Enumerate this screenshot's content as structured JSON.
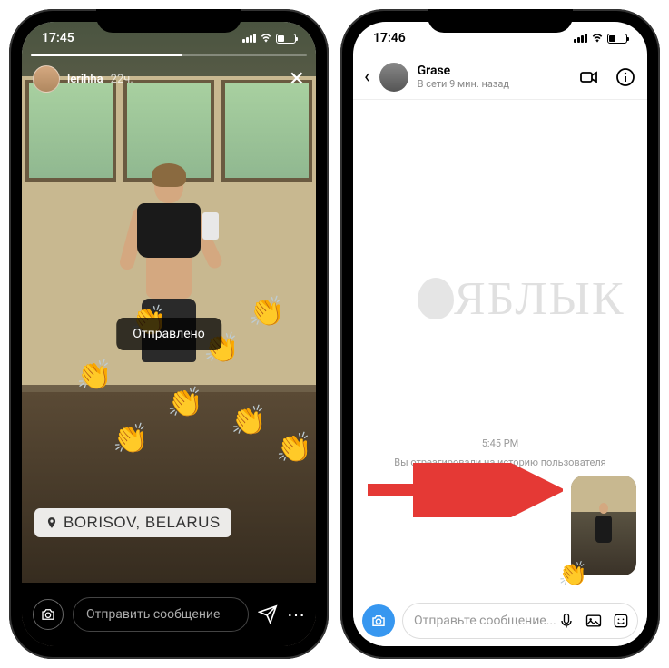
{
  "phone1": {
    "status_time": "17:45",
    "story": {
      "username": "lerihha",
      "time": "22ч.",
      "toast": "Отправлено",
      "location": "BORISOV, BELARUS",
      "reaction_emoji": "👏"
    },
    "footer": {
      "placeholder": "Отправить сообщение"
    }
  },
  "phone2": {
    "status_time": "17:46",
    "dm": {
      "name": "Grase",
      "status": "В сети 9 мин. назад",
      "timestamp": "5:45 PM",
      "caption": "Вы отреагировали на историю пользователя",
      "reaction_emoji": "👏"
    },
    "footer": {
      "placeholder": "Отправьте сообщение..."
    }
  },
  "watermark": "ЯБЛЫК"
}
